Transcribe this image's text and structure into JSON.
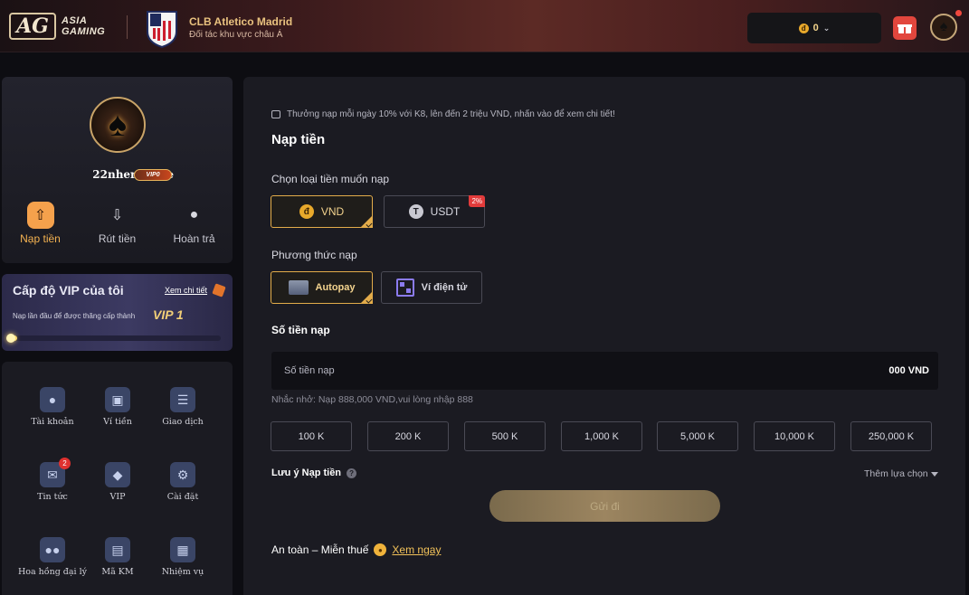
{
  "header": {
    "brand_mark": "AG",
    "brand_line1": "ASIA",
    "brand_line2": "GAMING",
    "club_name": "CLB Atletico Madrid",
    "club_subtitle": "Đối tác khu vực châu Á",
    "balance": "0",
    "coin_symbol": "đ"
  },
  "profile": {
    "username": "22nhermione",
    "vip_badge": "VIP0",
    "actions": [
      {
        "label": "Nạp tiền",
        "icon": "deposit-icon",
        "active": true
      },
      {
        "label": "Rút tiền",
        "icon": "withdraw-icon",
        "active": false
      },
      {
        "label": "Hoàn trả",
        "icon": "rebate-icon",
        "active": false
      }
    ]
  },
  "vip": {
    "title": "Cấp độ VIP của tôi",
    "link": "Xem chi tiết",
    "tip": "Nạp lần đầu để được thăng cấp thành",
    "next_level": "VIP 1",
    "progress": 0.04
  },
  "menu": [
    {
      "label": "Tài khoản",
      "icon": "account-icon"
    },
    {
      "label": "Ví tiền",
      "icon": "wallet-icon"
    },
    {
      "label": "Giao dịch",
      "icon": "transaction-icon"
    },
    {
      "label": "Tin tức",
      "icon": "news-icon",
      "badge": "2"
    },
    {
      "label": "VIP",
      "icon": "vip-diamond-icon"
    },
    {
      "label": "Cài đặt",
      "icon": "settings-icon"
    },
    {
      "label": "Hoa hồng đại lý",
      "icon": "agent-icon"
    },
    {
      "label": "Mã KM",
      "icon": "coupon-icon"
    },
    {
      "label": "Nhiệm vụ",
      "icon": "mission-icon"
    }
  ],
  "deposit": {
    "promo": "Thưởng nạp mỗi ngày 10% với K8, lên đến 2 triệu VND, nhấn vào để xem chi tiết!",
    "title": "Nạp tiền",
    "currency_label": "Chọn loại tiền muốn nạp",
    "currencies": [
      {
        "label": "VND",
        "selected": true
      },
      {
        "label": "USDT",
        "selected": false,
        "tag": "2%"
      }
    ],
    "method_label": "Phương thức nạp",
    "methods": [
      {
        "label": "Autopay",
        "selected": true
      },
      {
        "label": "Ví điện tử",
        "selected": false
      }
    ],
    "amount_label": "Số tiền nạp",
    "amount_placeholder": "Số tiền nạp",
    "amount_unit": "000 VND",
    "hint": "Nhắc nhở: Nạp 888,000 VND,vui lòng nhập 888",
    "chips": [
      "100 K",
      "200 K",
      "500 K",
      "1,000 K",
      "5,000 K",
      "10,000 K",
      "250,000 K"
    ],
    "note_label": "Lưu ý Nạp tiền",
    "more_options": "Thêm lựa chọn",
    "submit": "Gửi đi",
    "safe_text": "An toàn – Miễn thuế",
    "safe_link": "Xem ngay"
  }
}
